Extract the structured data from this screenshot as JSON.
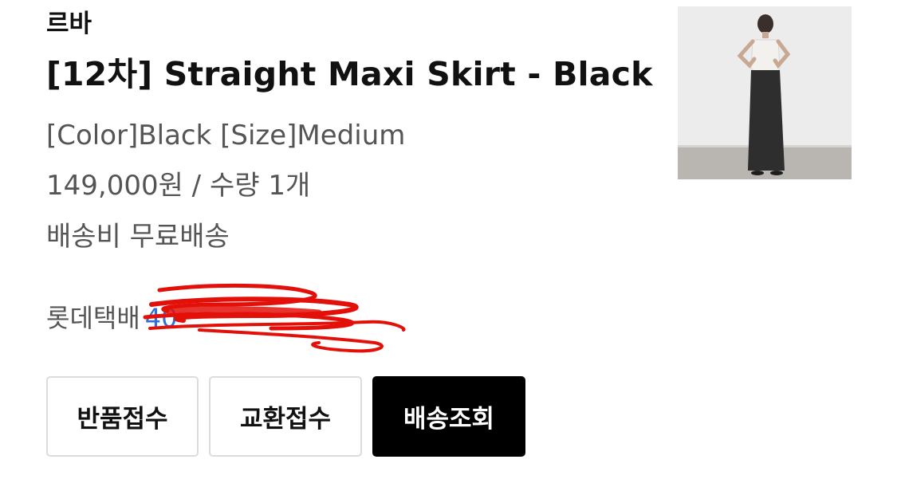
{
  "order_item": {
    "brand": "르바",
    "title": "[12차] Straight Maxi Skirt - Black",
    "options": "[Color]Black [Size]Medium",
    "price_qty": "149,000원 / 수량 1개",
    "shipping": "배송비 무료배송",
    "courier": "롯데택배",
    "tracking_number": "40"
  },
  "thumbnail": {
    "icon": "product-photo"
  },
  "actions": {
    "return_label": "반품접수",
    "exchange_label": "교환접수",
    "track_label": "배송조회"
  },
  "colors": {
    "primary_button_bg": "#000000",
    "link": "#2f6fd6",
    "redaction": "#e3100a"
  }
}
